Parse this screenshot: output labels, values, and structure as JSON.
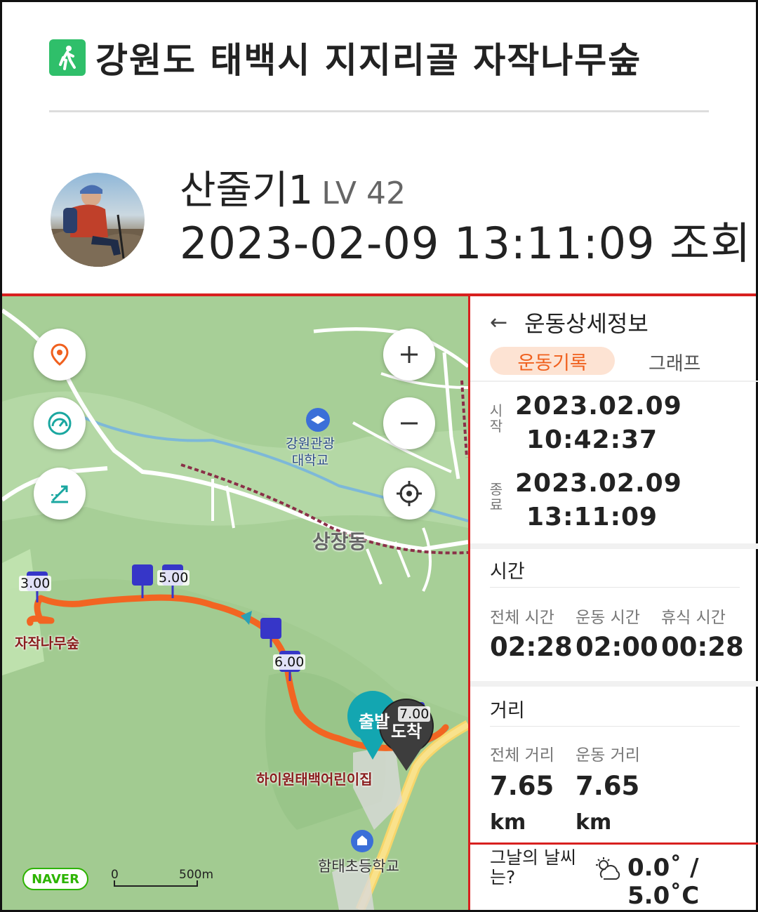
{
  "header": {
    "title": "강원도 태백시 지지리골 자작나무숲",
    "icon": "hiking-icon",
    "accent": "#2fbf6a"
  },
  "profile": {
    "name": "산줄기1",
    "level": "LV 42",
    "view_line": "2023-02-09 13:11:09 조회"
  },
  "map": {
    "labels": {
      "university": "강원관광\n대학교",
      "university_l1": "강원관광",
      "university_l2": "대학교",
      "sangjang": "상장동",
      "birch_forest": "자작나무숲",
      "daycare": "하이원태백어린이집",
      "school": "함태초등학교",
      "start": "출발",
      "arrive": "도착"
    },
    "km_markers": [
      "3.00",
      "5.00",
      "6.00",
      "7.00"
    ],
    "naver": "NAVER",
    "scale": {
      "zero": "0",
      "length": "500m"
    },
    "route_color": "#f26522",
    "buttons": [
      "location-pin-icon",
      "speedometer-icon",
      "slope-icon",
      "zoom-in-icon",
      "zoom-out-icon",
      "crosshair-icon"
    ]
  },
  "panel": {
    "title": "운동상세정보",
    "tabs": {
      "active": "운동기록",
      "other": "그래프"
    },
    "start": {
      "label": "시작",
      "date": "2023.02.09",
      "time": "10:42:37"
    },
    "end": {
      "label": "종료",
      "date": "2023.02.09",
      "time": "13:11:09"
    },
    "time_section": {
      "title": "시간",
      "total_label": "전체 시간",
      "total": "02:28",
      "moving_label": "운동 시간",
      "moving": "02:00",
      "rest_label": "휴식 시간",
      "rest": "00:28"
    },
    "distance_section": {
      "title": "거리",
      "total_label": "전체 거리",
      "total": "7.65",
      "total_unit": "km",
      "moving_label": "운동 거리",
      "moving": "7.65",
      "moving_unit": "km"
    },
    "weather": {
      "question": "그날의 날씨는?",
      "q_line1": "그날의 날씨",
      "q_line2": "는?",
      "line1": "0.0˚ /",
      "line2": "5.0˚C",
      "icon": "partly-cloudy-icon"
    }
  }
}
